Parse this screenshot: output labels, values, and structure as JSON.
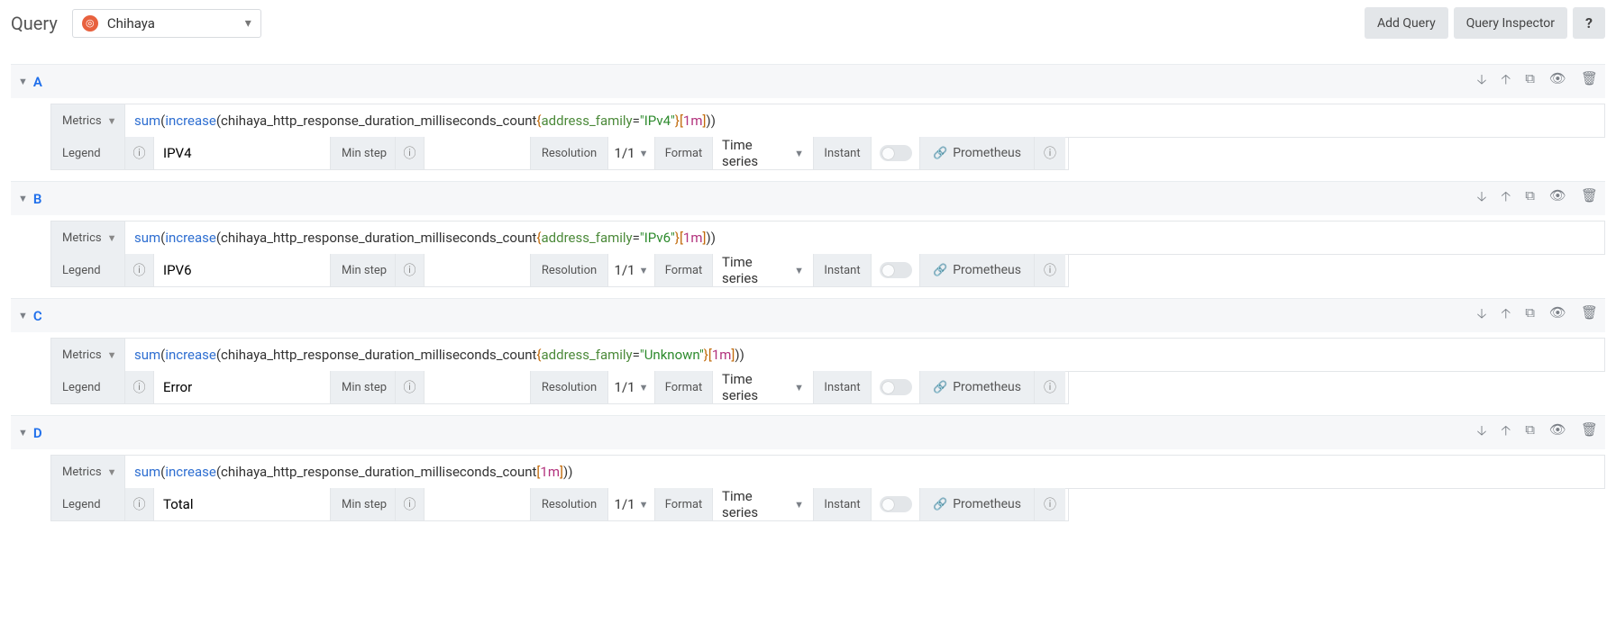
{
  "header": {
    "query_label": "Query",
    "datasource_name": "Chihaya",
    "add_query": "Add Query",
    "query_inspector": "Query Inspector",
    "help": "?"
  },
  "labels": {
    "metrics": "Metrics",
    "legend": "Legend",
    "min_step": "Min step",
    "resolution": "Resolution",
    "format": "Format",
    "instant": "Instant",
    "prometheus": "Prometheus"
  },
  "common": {
    "resolution_value": "1/1",
    "format_value": "Time series",
    "caret": "▾"
  },
  "queries": [
    {
      "letter": "A",
      "legend": "IPV4",
      "expr": {
        "fn1": "sum",
        "fn2": "increase",
        "metric": "chihaya_http_response_duration_milliseconds_count",
        "has_filter": true,
        "filter_key": "address_family",
        "filter_val": "\"IPv4\"",
        "dur": "1m"
      }
    },
    {
      "letter": "B",
      "legend": "IPV6",
      "expr": {
        "fn1": "sum",
        "fn2": "increase",
        "metric": "chihaya_http_response_duration_milliseconds_count",
        "has_filter": true,
        "filter_key": "address_family",
        "filter_val": "\"IPv6\"",
        "dur": "1m"
      }
    },
    {
      "letter": "C",
      "legend": "Error",
      "expr": {
        "fn1": "sum",
        "fn2": "increase",
        "metric": "chihaya_http_response_duration_milliseconds_count",
        "has_filter": true,
        "filter_key": "address_family",
        "filter_val": "\"Unknown\"",
        "dur": "1m"
      }
    },
    {
      "letter": "D",
      "legend": "Total",
      "expr": {
        "fn1": "sum",
        "fn2": "increase",
        "metric": "chihaya_http_response_duration_milliseconds_count",
        "has_filter": false,
        "dur": "1m"
      }
    }
  ]
}
